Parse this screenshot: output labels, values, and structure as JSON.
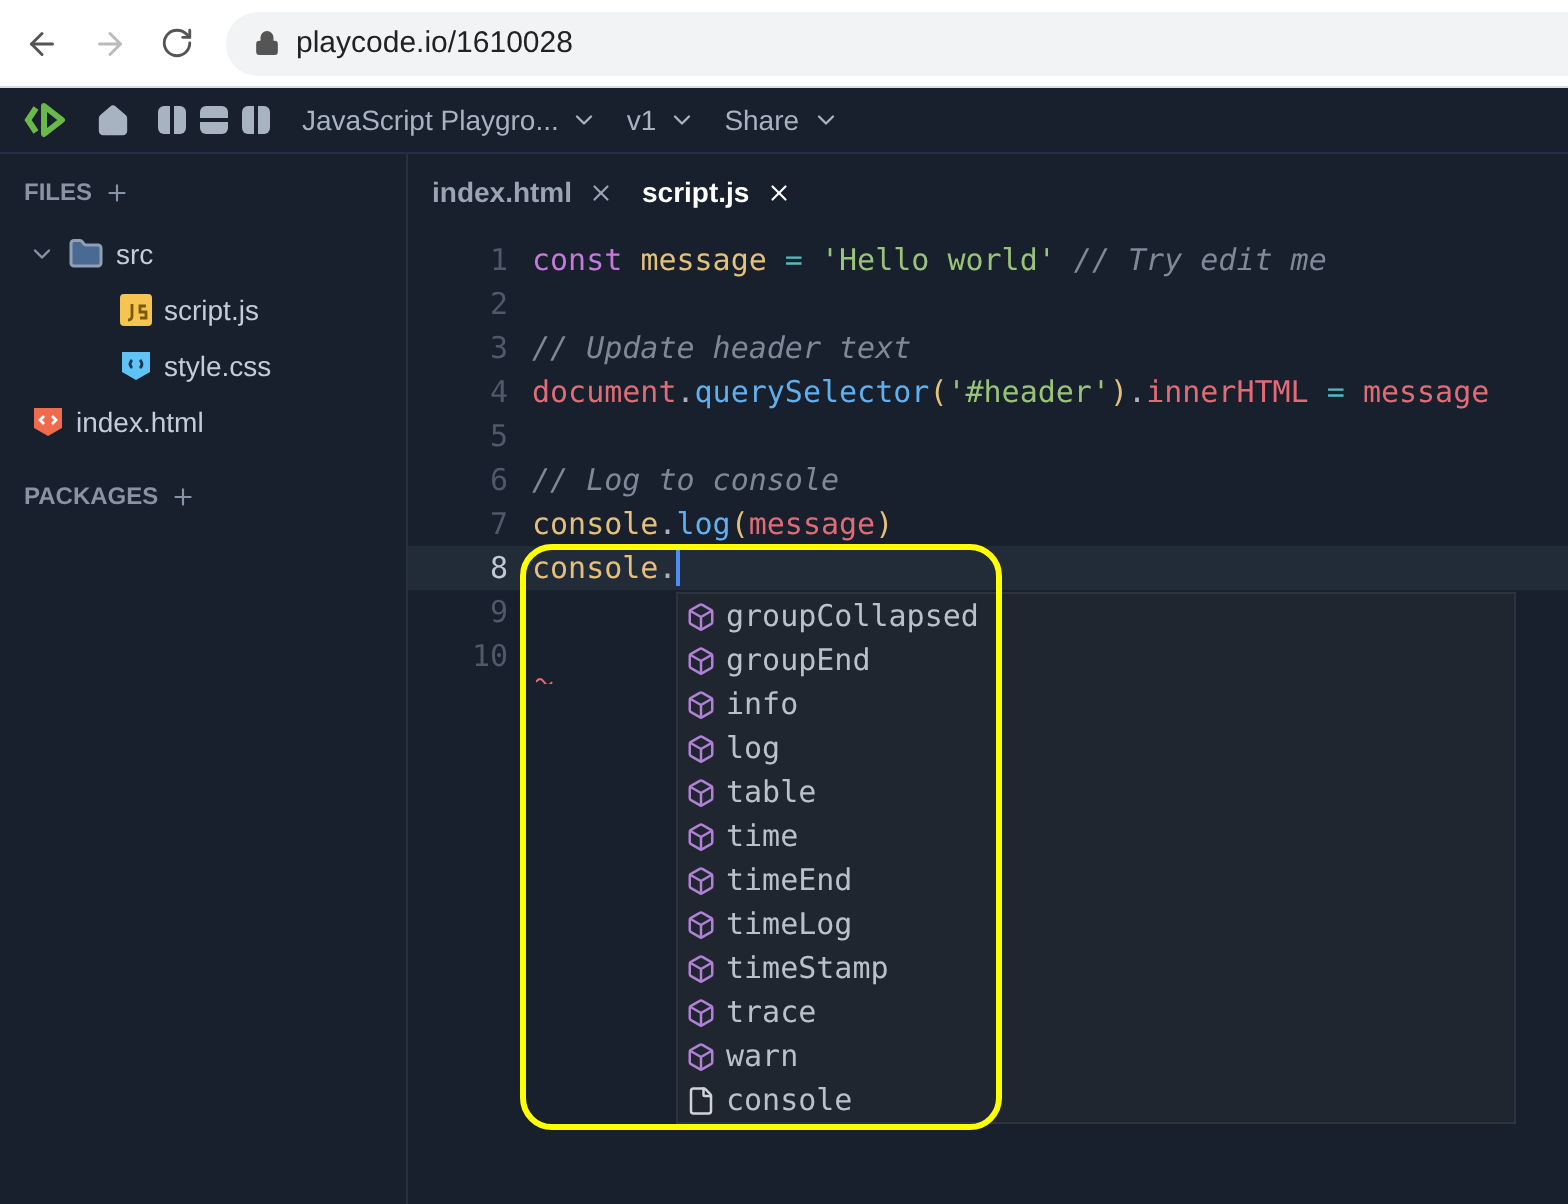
{
  "browser": {
    "url": "playcode.io/1610028"
  },
  "header": {
    "project": "JavaScript Playgro...",
    "version": "v1",
    "share": "Share"
  },
  "sidebar": {
    "files_title": "FILES",
    "packages_title": "PACKAGES",
    "tree": [
      {
        "name": "src",
        "kind": "folder",
        "expanded": true,
        "children": [
          {
            "name": "script.js",
            "kind": "js"
          },
          {
            "name": "style.css",
            "kind": "css"
          }
        ]
      },
      {
        "name": "index.html",
        "kind": "html"
      }
    ]
  },
  "tabs": [
    {
      "label": "index.html",
      "selected": false
    },
    {
      "label": "script.js",
      "selected": true
    }
  ],
  "editor": {
    "lines": [
      {
        "number": "1",
        "active": false,
        "tokens": [
          {
            "kind": "keyword",
            "text": "const "
          },
          {
            "kind": "variable",
            "text": "message"
          },
          {
            "kind": "operator",
            "text": " = "
          },
          {
            "kind": "string",
            "text": "'Hello world'"
          },
          {
            "kind": "comment",
            "text": " // Try edit me"
          }
        ]
      },
      {
        "number": "2",
        "active": false
      },
      {
        "number": "3",
        "active": false,
        "tokens": [
          {
            "kind": "comment",
            "text": "// Update header text"
          }
        ]
      },
      {
        "number": "4",
        "active": false,
        "tokens": [
          {
            "kind": "property",
            "text": "document"
          },
          {
            "kind": "plain",
            "text": "."
          },
          {
            "kind": "function",
            "text": "querySelector"
          },
          {
            "kind": "paren",
            "text": "("
          },
          {
            "kind": "string",
            "text": "'#header'"
          },
          {
            "kind": "paren",
            "text": ")"
          },
          {
            "kind": "plain",
            "text": "."
          },
          {
            "kind": "property",
            "text": "innerHTML"
          },
          {
            "kind": "operator",
            "text": " = "
          },
          {
            "kind": "property",
            "text": "message"
          }
        ]
      },
      {
        "number": "5",
        "active": false
      },
      {
        "number": "6",
        "active": false,
        "tokens": [
          {
            "kind": "comment",
            "text": "// Log to console"
          }
        ]
      },
      {
        "number": "7",
        "active": false,
        "tokens": [
          {
            "kind": "variable",
            "text": "console"
          },
          {
            "kind": "plain",
            "text": "."
          },
          {
            "kind": "function",
            "text": "log"
          },
          {
            "kind": "paren",
            "text": "("
          },
          {
            "kind": "property",
            "text": "message"
          },
          {
            "kind": "paren",
            "text": ")"
          }
        ]
      },
      {
        "number": "8",
        "active": true,
        "tokens": [
          {
            "kind": "variable",
            "text": "console"
          },
          {
            "kind": "plain",
            "text": "."
          }
        ]
      },
      {
        "number": "9",
        "active": false
      },
      {
        "number": "10",
        "active": false
      }
    ],
    "suggestions": [
      {
        "label": "groupCollapsed",
        "kind": "method"
      },
      {
        "label": "groupEnd",
        "kind": "method"
      },
      {
        "label": "info",
        "kind": "method"
      },
      {
        "label": "log",
        "kind": "method"
      },
      {
        "label": "table",
        "kind": "method"
      },
      {
        "label": "time",
        "kind": "method"
      },
      {
        "label": "timeEnd",
        "kind": "method"
      },
      {
        "label": "timeLog",
        "kind": "method"
      },
      {
        "label": "timeStamp",
        "kind": "method"
      },
      {
        "label": "trace",
        "kind": "method"
      },
      {
        "label": "warn",
        "kind": "method"
      },
      {
        "label": "console",
        "kind": "text"
      }
    ]
  }
}
